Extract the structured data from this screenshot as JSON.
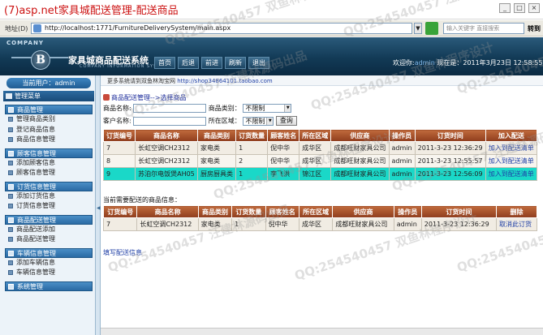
{
  "window": {
    "title": "(7)asp.net家具城配送管理-配送商品"
  },
  "addressbar": {
    "label": "地址(D)",
    "url": "http://localhost:1771/FurnitureDeliverySystem/main.aspx",
    "search_placeholder": "输入关键字 直接搜索",
    "side_label": "转到"
  },
  "header": {
    "company": "COMPANY",
    "logo_letter": "B",
    "system_title": "家具城商品配送系统",
    "subtitle": "COMPANY INFORMATION SYSTEM",
    "nav": [
      "首页",
      "后退",
      "前进",
      "刷新",
      "退出"
    ],
    "welcome_prefix": "欢迎你:",
    "welcome_user": "admin",
    "date_text": "现在是：2011年3月23日  12:58:55"
  },
  "sidebar": {
    "current_user": "当前用户：admin",
    "menu_title": "管理菜单",
    "groups": [
      {
        "title": "商品管理",
        "items": [
          "管理商品类别",
          "登记商品信息",
          "商品信息管理"
        ]
      },
      {
        "title": "顾客信息管理",
        "items": [
          "添加顾客信息",
          "顾客信息管理"
        ]
      },
      {
        "title": "订货信息管理",
        "items": [
          "添加订货信息",
          "订货信息管理"
        ]
      },
      {
        "title": "商品配送管理",
        "items": [
          "商品配送添加",
          "商品配送管理"
        ]
      },
      {
        "title": "车辆信息管理",
        "items": [
          "添加车辆信息",
          "车辆信息管理"
        ]
      },
      {
        "title": "系统管理",
        "items": []
      }
    ]
  },
  "main": {
    "top_links_text": "更多系统请到双鱼林淘宝网",
    "top_links_url": "http://shop34864101.taobao.com",
    "breadcrumb": "商品配送管理-->选择商品",
    "search": {
      "product_name_label": "商品名称:",
      "category_label": "商品类别：",
      "category_value": "不限制",
      "customer_label": "客户名称:",
      "region_label": "所在区域：",
      "region_value": "不限制",
      "query_button": "查询"
    },
    "orders_table": {
      "headers": [
        "订货编号",
        "商品名称",
        "商品类别",
        "订货数量",
        "顾客姓名",
        "所在区域",
        "供应商",
        "操作员",
        "订货时间",
        "加入配送"
      ],
      "rows": [
        [
          "7",
          "长虹空调CH2312",
          "家电类",
          "1",
          "倪中华",
          "成华区",
          "成都旺财家具公司",
          "admin",
          "2011-3-23 12:36:29",
          "加入到配送清单"
        ],
        [
          "8",
          "长虹空调CH2312",
          "家电类",
          "2",
          "倪中华",
          "成华区",
          "成都旺财家具公司",
          "admin",
          "2011-3-23 12:55:57",
          "加入到配送清单"
        ],
        [
          "9",
          "苏泊尔电饭煲AH05",
          "厨房厨具类",
          "1",
          "李飞洪",
          "锦江区",
          "成都旺财家具公司",
          "admin",
          "2011-3-23 12:56:09",
          "加入到配送清单"
        ]
      ]
    },
    "pending_label": "当前需要配送的商品信息：",
    "pending_table": {
      "headers": [
        "订货编号",
        "商品名称",
        "商品类别",
        "订货数量",
        "顾客姓名",
        "所在区域",
        "供应商",
        "操作员",
        "订货时间",
        "删除"
      ],
      "rows": [
        [
          "7",
          "长虹空调CH2312",
          "家电类",
          "1",
          "倪中华",
          "成华区",
          "成都旺财家具公司",
          "admin",
          "2011-3-23 12:36:29",
          "取消此订货"
        ]
      ]
    },
    "fill_link": "填写配送信息"
  },
  "watermark": [
    "QQ:254540457 双鱼林程序设计",
    "QQ:254540457 汪建林源码出品"
  ]
}
